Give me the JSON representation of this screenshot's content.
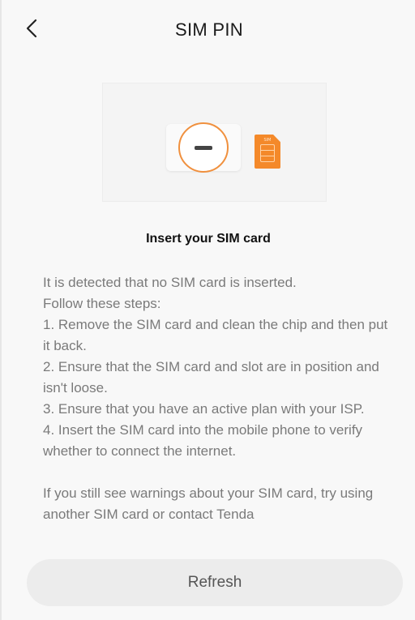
{
  "header": {
    "title": "SIM PIN",
    "back_icon": "chevron-left-icon"
  },
  "illustration": {
    "sim_label": "SIM",
    "accent_color": "#f0903e"
  },
  "main": {
    "subheading": "Insert your SIM card",
    "paragraphs": [
      "It is detected that no SIM card is inserted.",
      "Follow these steps:",
      "1. Remove the SIM card and clean the chip and then put it back.",
      "2. Ensure that the SIM card and slot are in position and isn't loose.",
      "3. Ensure that you have an active plan with your ISP.",
      "4. Insert the SIM card into the mobile phone to verify whether to connect the internet."
    ],
    "footer_note": "If you still see warnings about your SIM card, try using another SIM card or contact Tenda"
  },
  "footer": {
    "refresh_label": "Refresh"
  }
}
